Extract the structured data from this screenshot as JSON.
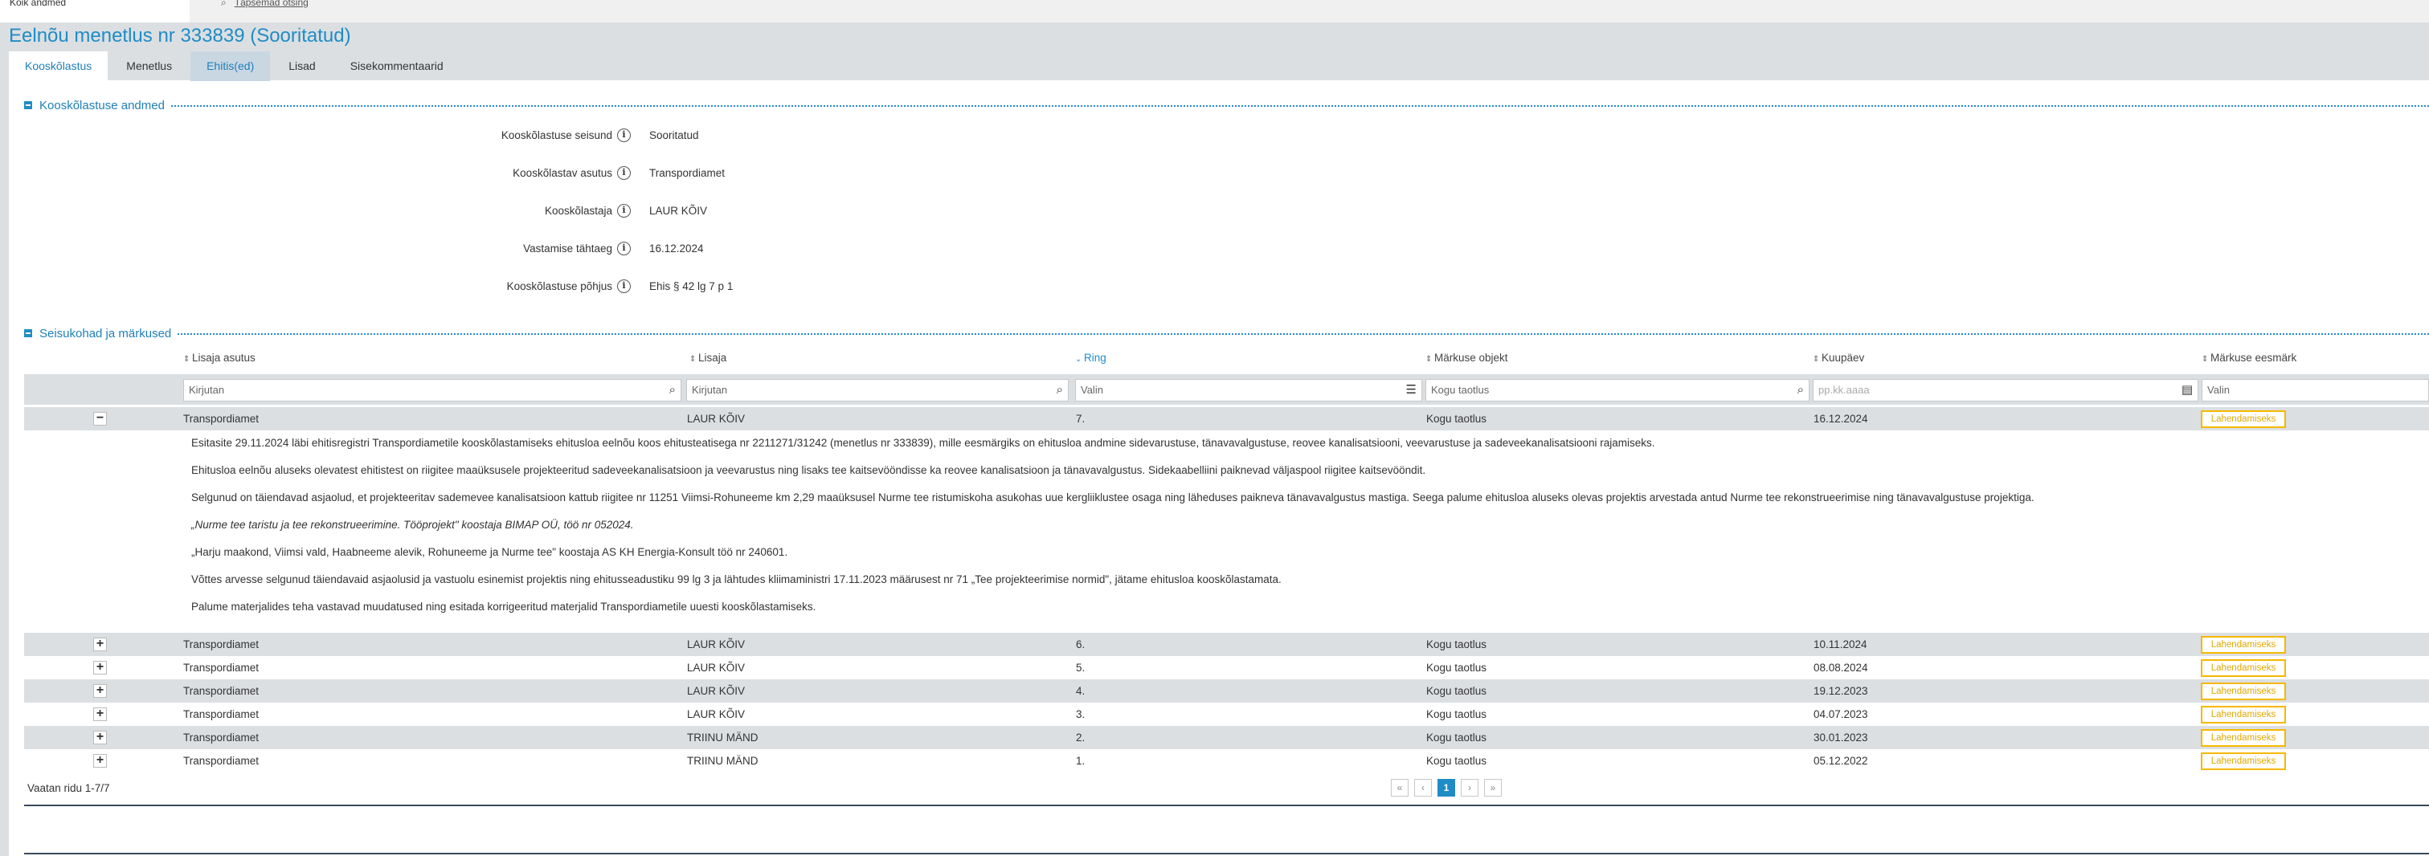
{
  "topbar": {
    "left_text": "Kõik andmed",
    "link_text": "Täpsemad otsing"
  },
  "page_title": "Eelnõu menetlus nr 333839 (Sooritatud)",
  "tabs": [
    {
      "label": "Kooskõlastus"
    },
    {
      "label": "Menetlus"
    },
    {
      "label": "Ehitis(ed)"
    },
    {
      "label": "Lisad"
    },
    {
      "label": "Sisekommentaarid"
    }
  ],
  "section1": {
    "title": "Kooskõlastuse andmed",
    "fields": [
      {
        "label": "Kooskõlastuse seisund",
        "value": "Sooritatud"
      },
      {
        "label": "Kooskõlastav asutus",
        "value": "Transpordiamet"
      },
      {
        "label": "Kooskõlastaja",
        "value": "LAUR KÕIV"
      },
      {
        "label": "Vastamise tähtaeg",
        "value": "16.12.2024"
      },
      {
        "label": "Kooskõlastuse põhjus",
        "value": "Ehis § 42 lg 7 p 1"
      }
    ]
  },
  "section2": {
    "title": "Seisukohad ja märkused",
    "columns": [
      {
        "label": "Lisaja asutus",
        "filter": "Kirjutan"
      },
      {
        "label": "Lisaja",
        "filter": "Kirjutan"
      },
      {
        "label": "Ring",
        "filter": "Valin"
      },
      {
        "label": "Märkuse objekt",
        "filter": "Kogu taotlus"
      },
      {
        "label": "Kuupäev",
        "filter": "pp.kk.aaaa"
      },
      {
        "label": "Märkuse eesmärk",
        "filter": "Valin"
      }
    ],
    "rows": [
      {
        "asutus": "Transpordiamet",
        "lisaja": "LAUR KÕIV",
        "ring": "7.",
        "objekt": "Kogu taotlus",
        "kuupaev": "16.12.2024",
        "eesmark": "Lahendamiseks"
      },
      {
        "asutus": "Transpordiamet",
        "lisaja": "LAUR KÕIV",
        "ring": "6.",
        "objekt": "Kogu taotlus",
        "kuupaev": "10.11.2024",
        "eesmark": "Lahendamiseks"
      },
      {
        "asutus": "Transpordiamet",
        "lisaja": "LAUR KÕIV",
        "ring": "5.",
        "objekt": "Kogu taotlus",
        "kuupaev": "08.08.2024",
        "eesmark": "Lahendamiseks"
      },
      {
        "asutus": "Transpordiamet",
        "lisaja": "LAUR KÕIV",
        "ring": "4.",
        "objekt": "Kogu taotlus",
        "kuupaev": "19.12.2023",
        "eesmark": "Lahendamiseks"
      },
      {
        "asutus": "Transpordiamet",
        "lisaja": "LAUR KÕIV",
        "ring": "3.",
        "objekt": "Kogu taotlus",
        "kuupaev": "04.07.2023",
        "eesmark": "Lahendamiseks"
      },
      {
        "asutus": "Transpordiamet",
        "lisaja": "TRIINU MÄND",
        "ring": "2.",
        "objekt": "Kogu taotlus",
        "kuupaev": "30.01.2023",
        "eesmark": "Lahendamiseks"
      },
      {
        "asutus": "Transpordiamet",
        "lisaja": "TRIINU MÄND",
        "ring": "1.",
        "objekt": "Kogu taotlus",
        "kuupaev": "05.12.2022",
        "eesmark": "Lahendamiseks"
      }
    ],
    "detail_paragraphs": [
      "Esitasite 29.11.2024 läbi ehitisregistri Transpordiametile kooskõlastamiseks ehitusloa eelnõu koos ehitusteatisega nr 2211271/31242 (menetlus nr 333839), mille eesmärgiks on ehitusloa andmine sidevarustuse, tänavavalgustuse, reovee kanalisatsiooni, veevarustuse ja sadeveekanalisatsiooni rajamiseks.",
      "Ehitusloa eelnõu aluseks olevatest ehitistest on riigitee maaüksusele projekteeritud sadeveekanalisatsioon ja veevarustus ning lisaks tee kaitsevööndisse ka reovee kanalisatsioon ja tänavavalgustus. Sidekaabelliini paiknevad väljaspool riigitee kaitsevööndit.",
      "Selgunud on täiendavad asjaolud, et projekteeritav sademevee kanalisatsioon kattub riigitee nr 11251 Viimsi-Rohuneeme km 2,29 maaüksusel Nurme tee ristumiskoha asukohas uue kergliiklustee osaga ning läheduses paikneva tänavavalgustus mastiga. Seega palume ehitusloa aluseks olevas projektis arvestada antud Nurme tee rekonstrueerimise ning tänavavalgustuse projektiga.",
      "„Nurme tee taristu ja tee rekonstrueerimine. Tööprojekt\" koostaja BIMAP OÜ, töö nr 052024.",
      "„Harju maakond, Viimsi vald, Haabneeme alevik, Rohuneeme ja Nurme tee\" koostaja AS KH Energia-Konsult töö nr 240601.",
      "Võttes arvesse selgunud täiendavaid asjaolusid ja vastuolu esinemist projektis ning ehitusseadustiku 99 lg 3 ja lähtudes kliimaministri 17.11.2023 määrusest nr 71 „Tee projekteerimise normid\", jätame ehitusloa kooskõlastamata.",
      "Palume materjalides teha vastavad muudatused ning esitada korrigeeritud materjalid Transpordiametile uuesti kooskõlastamiseks."
    ],
    "pager_text": "Vaatan ridu 1-7/7",
    "current_page": "1"
  },
  "colors": {
    "accent": "#1f8cc6",
    "header_bg": "#dcdfe2",
    "badge": "#f5b800"
  }
}
